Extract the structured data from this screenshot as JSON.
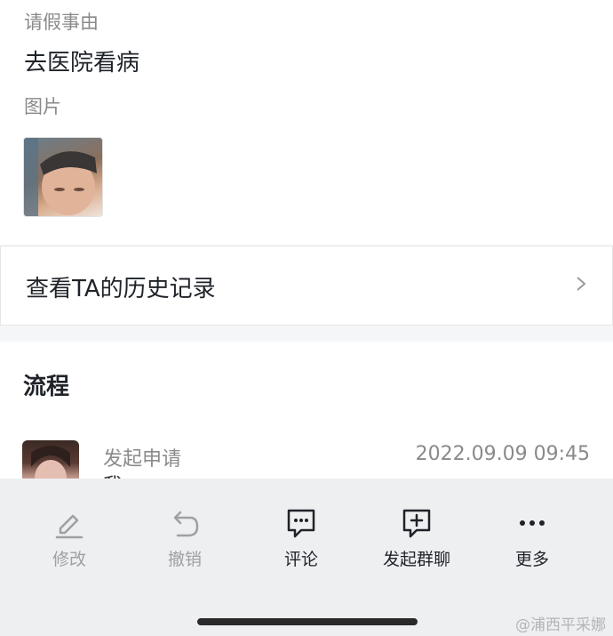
{
  "leave": {
    "reason_label": "请假事由",
    "reason_value": "去医院看病",
    "images_label": "图片"
  },
  "history": {
    "label": "查看TA的历史记录"
  },
  "flow": {
    "title": "流程",
    "step": {
      "label": "发起申请",
      "time": "2022.09.09 09:45",
      "who": "我"
    }
  },
  "actions": [
    {
      "label": "修改",
      "icon": "edit-icon",
      "enabled": false
    },
    {
      "label": "撤销",
      "icon": "undo-icon",
      "enabled": false
    },
    {
      "label": "评论",
      "icon": "comment-icon",
      "enabled": true
    },
    {
      "label": "发起群聊",
      "icon": "add-group-chat-icon",
      "enabled": true
    },
    {
      "label": "更多",
      "icon": "more-icon",
      "enabled": true
    }
  ],
  "watermark": "@浦西平采娜"
}
